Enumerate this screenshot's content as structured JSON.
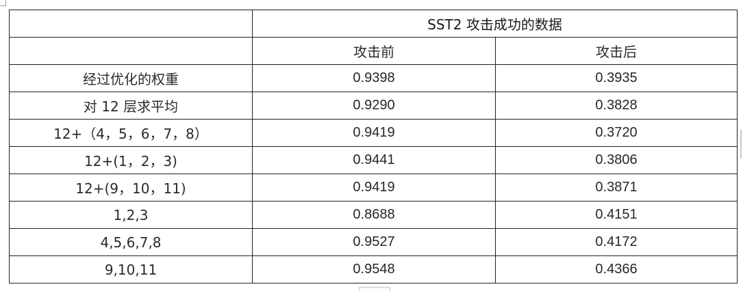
{
  "table": {
    "group_header": "SST2 攻击成功的数据",
    "col_before": "攻击前",
    "col_after": "攻击后",
    "rows": [
      {
        "label": "经过优化的权重",
        "before": "0.9398",
        "after": "0.3935"
      },
      {
        "label": "对 12 层求平均",
        "before": "0.9290",
        "after": "0.3828"
      },
      {
        "label": "12+（4，5，6，7，8）",
        "before": "0.9419",
        "after": "0.3720"
      },
      {
        "label": "12+(1，2，3)",
        "before": "0.9441",
        "after": "0.3806"
      },
      {
        "label": "12+(9，10，11)",
        "before": "0.9419",
        "after": "0.3871"
      },
      {
        "label": "1,2,3",
        "before": "0.8688",
        "after": "0.4151"
      },
      {
        "label": "4,5,6,7,8",
        "before": "0.9527",
        "after": "0.4172"
      },
      {
        "label": "9,10,11",
        "before": "0.9548",
        "after": "0.4366"
      }
    ]
  }
}
